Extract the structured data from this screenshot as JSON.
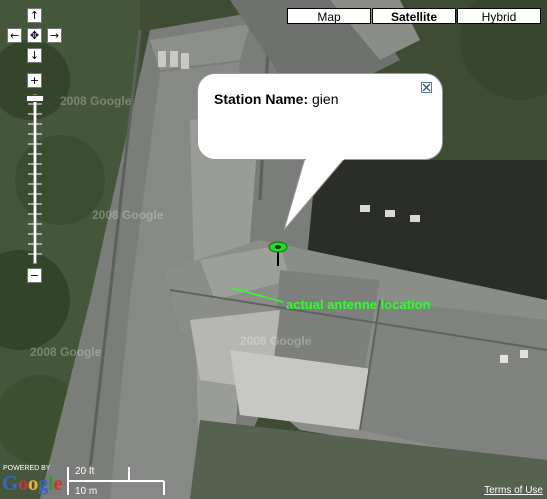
{
  "map_types": {
    "map": "Map",
    "satellite": "Satellite",
    "hybrid": "Hybrid",
    "active": "satellite"
  },
  "controls": {
    "pan_up_icon": "↑",
    "pan_left_icon": "←",
    "pan_center_icon": "✥",
    "pan_right_icon": "→",
    "pan_down_icon": "↓",
    "zoom_in_icon": "+",
    "zoom_out_icon": "−"
  },
  "info_window": {
    "label": "Station Name:",
    "value": "gien"
  },
  "annotation": "actual antenne location",
  "watermark": "2008 Google",
  "logo": {
    "powered": "POWERED BY",
    "text": "Google"
  },
  "scale": {
    "imperial": "20 ft",
    "metric": "10 m"
  },
  "terms": "Terms of Use",
  "colors": {
    "marker": "#22dd22",
    "annotation": "#2bff2b"
  }
}
